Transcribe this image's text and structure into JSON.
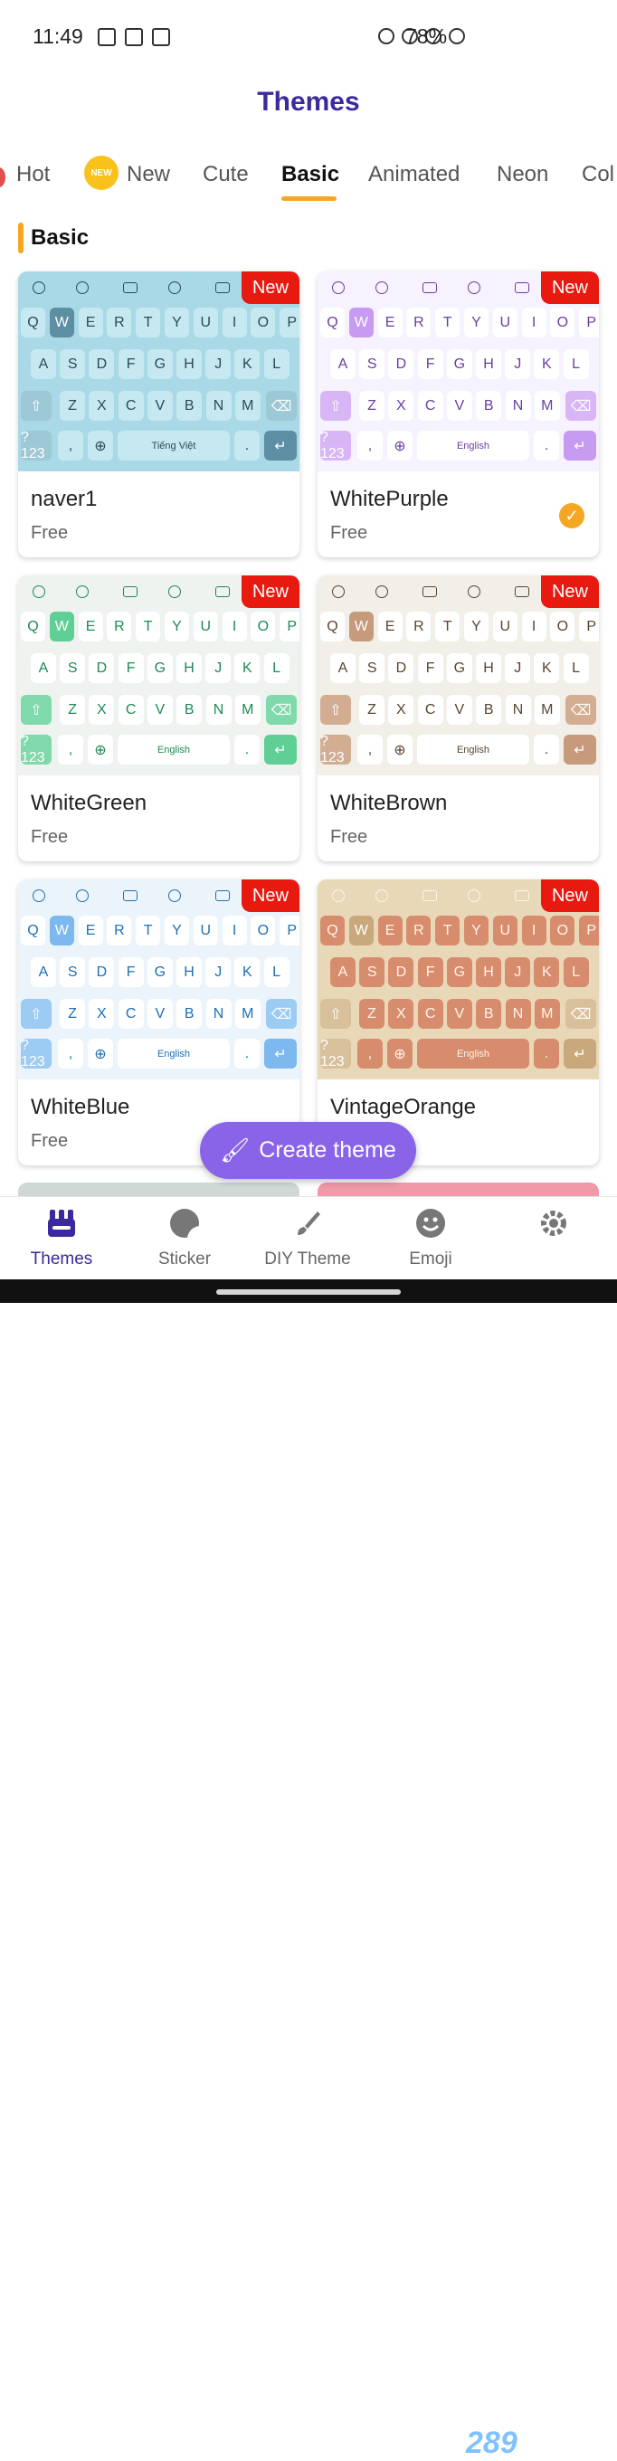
{
  "status_bar": {
    "time": "11:49",
    "battery": "78%"
  },
  "header": {
    "title": "Themes"
  },
  "tabs": [
    {
      "label": "Hot"
    },
    {
      "label": "New",
      "badge": "NEW"
    },
    {
      "label": "Cute"
    },
    {
      "label": "Basic",
      "active": true
    },
    {
      "label": "Animated"
    },
    {
      "label": "Neon"
    },
    {
      "label": "Col"
    }
  ],
  "section": {
    "title": "Basic"
  },
  "theme_cards": [
    {
      "name": "naver1",
      "price": "Free",
      "tag": "New",
      "space_label": "Tiếng Việt",
      "selected": false,
      "colors": {
        "bg": "#a9d9e6",
        "key": "#c6e8f1",
        "key_text": "#2c4a55",
        "accent": "#5c8fa3",
        "special": "#9dc8d6"
      }
    },
    {
      "name": "WhitePurple",
      "price": "Free",
      "tag": "New",
      "space_label": "English",
      "selected": true,
      "colors": {
        "bg": "#f6f2ff",
        "key": "#ffffff",
        "key_text": "#6a3ea0",
        "accent": "#c79bf2",
        "special": "#d8b6f6"
      }
    },
    {
      "name": "WhiteGreen",
      "price": "Free",
      "tag": "New",
      "space_label": "English",
      "selected": false,
      "colors": {
        "bg": "#eef3ef",
        "key": "#ffffff",
        "key_text": "#1e8a52",
        "accent": "#5fcf95",
        "special": "#7fd9aa"
      }
    },
    {
      "name": "WhiteBrown",
      "price": "Free",
      "tag": "New",
      "space_label": "English",
      "selected": false,
      "colors": {
        "bg": "#f2efe8",
        "key": "#ffffff",
        "key_text": "#5a4430",
        "accent": "#c79a7c",
        "special": "#d3ad92"
      }
    },
    {
      "name": "WhiteBlue",
      "price": "Free",
      "tag": "New",
      "space_label": "English",
      "selected": false,
      "colors": {
        "bg": "#ecf4fb",
        "key": "#ffffff",
        "key_text": "#1d6fb3",
        "accent": "#7db8ee",
        "special": "#9ccbf3"
      }
    },
    {
      "name": "VintageOrange",
      "price": "Free",
      "tag": "New",
      "space_label": "English",
      "selected": false,
      "colors": {
        "bg": "#e8d8b8",
        "key": "#d88c6e",
        "key_text": "#fff5e8",
        "accent": "#c9a97c",
        "special": "#d8c09a"
      }
    }
  ],
  "keyboard": {
    "row1": [
      "Q",
      "W",
      "E",
      "R",
      "T",
      "Y",
      "U",
      "I",
      "O",
      "P"
    ],
    "row2": [
      "A",
      "S",
      "D",
      "F",
      "G",
      "H",
      "J",
      "K",
      "L"
    ],
    "row3": [
      "Z",
      "X",
      "C",
      "V",
      "B",
      "N",
      "M"
    ],
    "num_key": "?123",
    "comma": ",",
    "period": ".",
    "toolbar_gif": "GIF",
    "toolbar_art": "ART"
  },
  "fab": {
    "label": "Create theme"
  },
  "bottom_nav": [
    {
      "label": "Themes",
      "icon": "themes-icon",
      "active": true
    },
    {
      "label": "Sticker",
      "icon": "sticker-icon"
    },
    {
      "label": "DIY Theme",
      "icon": "brush-icon"
    },
    {
      "label": "Emoji",
      "icon": "emoji-icon"
    },
    {
      "label": "",
      "icon": "gear-icon"
    }
  ],
  "watermark": "289"
}
